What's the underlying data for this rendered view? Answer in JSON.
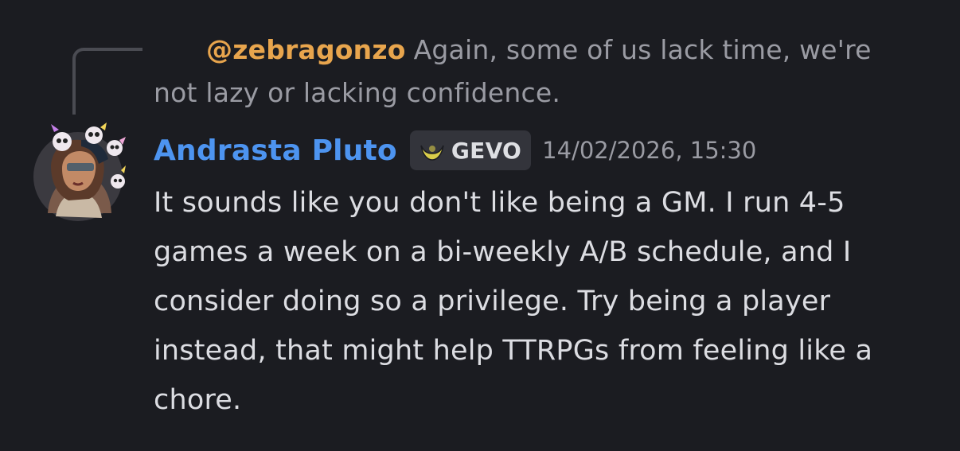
{
  "reply": {
    "mention": "@zebragonzo",
    "text": "Again, some of us lack time, we're not lazy or lacking confidence."
  },
  "message": {
    "author": "Andrasta Pluto",
    "tag_icon": "crescent-moon-icon",
    "tag_label": "GEVO",
    "timestamp": "14/02/2026, 15:30",
    "body": "It sounds like you don't like being a GM. I run 4-5 games a week on a bi-weekly A/B schedule, and I consider doing so a privilege. Try being a player instead, that might help TTRPGs from feeling like a chore."
  },
  "colors": {
    "background": "#1b1c21",
    "author": "#4d94f0",
    "mention": "#e8a54d",
    "muted_text": "#9a9ba3",
    "body_text": "#dcdde2",
    "tag_background": "#33343b",
    "tag_icon": "#d8cc4a"
  }
}
